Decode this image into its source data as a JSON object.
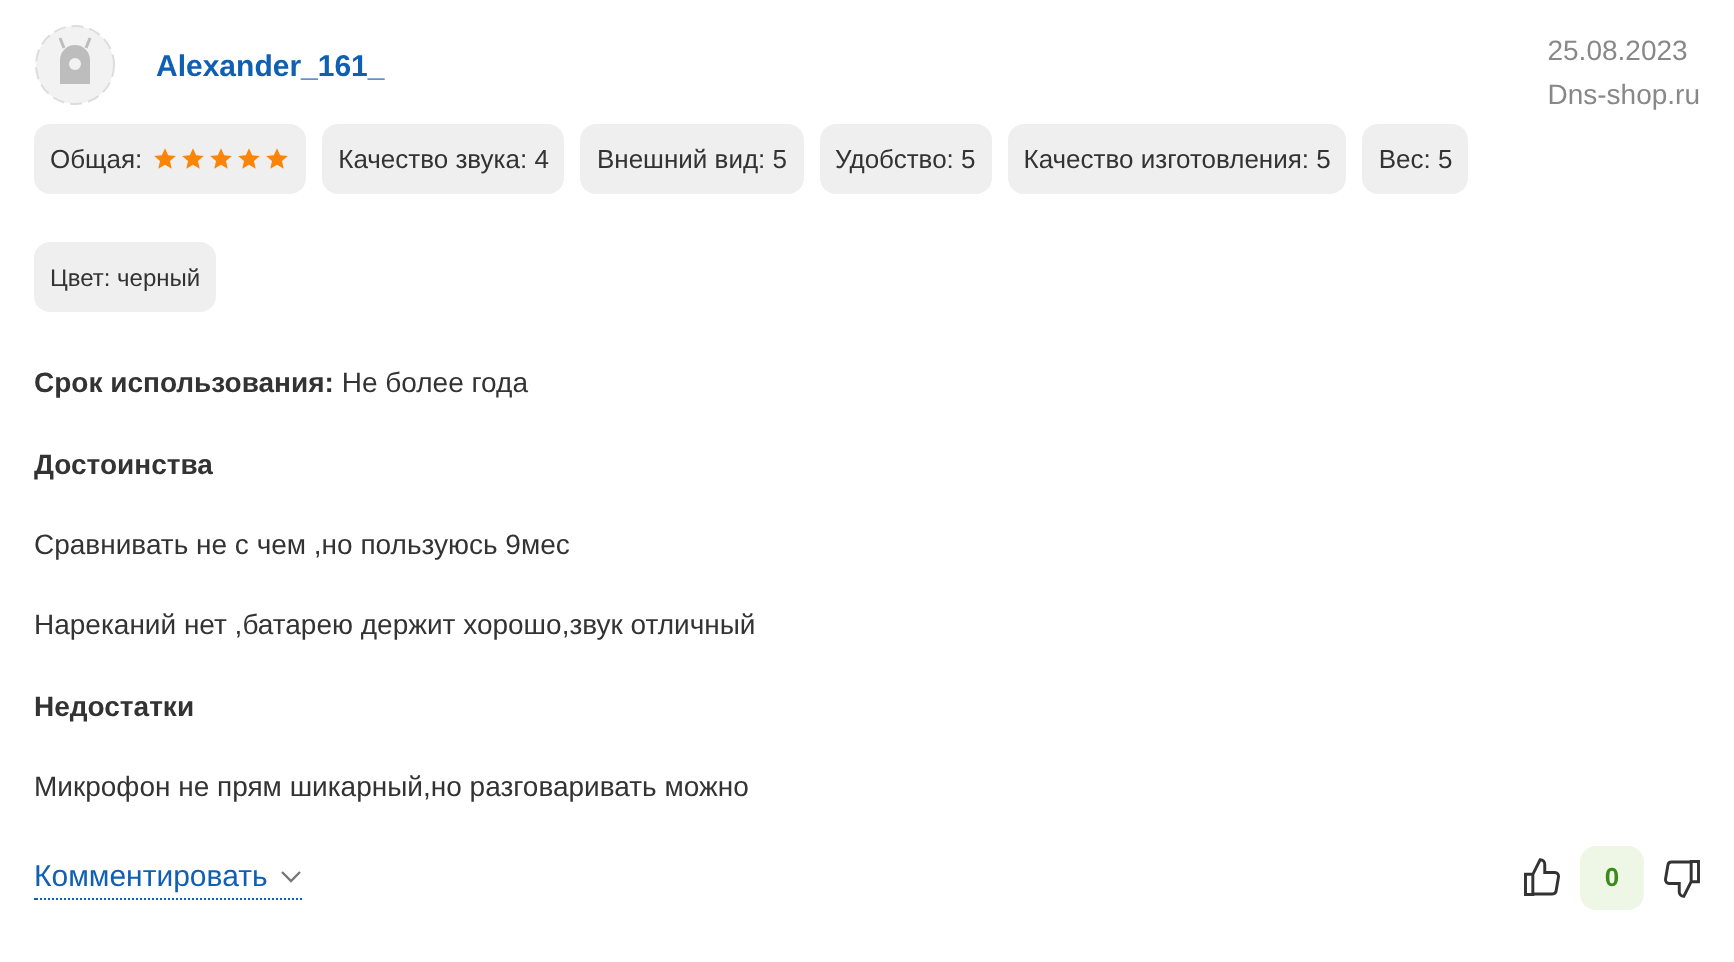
{
  "review": {
    "author": "Alexander_161_",
    "date": "25.08.2023",
    "source": "Dns-shop.ru",
    "ratings": [
      {
        "kind": "stars",
        "label": "Общая:",
        "stars": 5
      },
      {
        "kind": "text",
        "label": "Качество звука: 4"
      },
      {
        "kind": "text",
        "label": "Внешний вид: 5"
      },
      {
        "kind": "text",
        "label": "Удобство: 5"
      },
      {
        "kind": "text",
        "label": "Качество изготовления: 5"
      },
      {
        "kind": "text",
        "label": "Вес: 5"
      }
    ],
    "tags": [
      "Цвет: черный"
    ],
    "usage": "**Срок использования:** Не более года",
    "sections": [
      {
        "title": "Достоинства",
        "lines": [
          "Сравнивать не с чем ,но пользуюсь 9мес",
          "Нареканий нет ,батарею держит хорошо,звук отличный"
        ]
      },
      {
        "title": "Недостатки",
        "lines": [
          "Микрофон не прям шикарный,но разговаривать можно"
        ]
      }
    ],
    "comment_link": "Комментировать",
    "votes": "0"
  }
}
